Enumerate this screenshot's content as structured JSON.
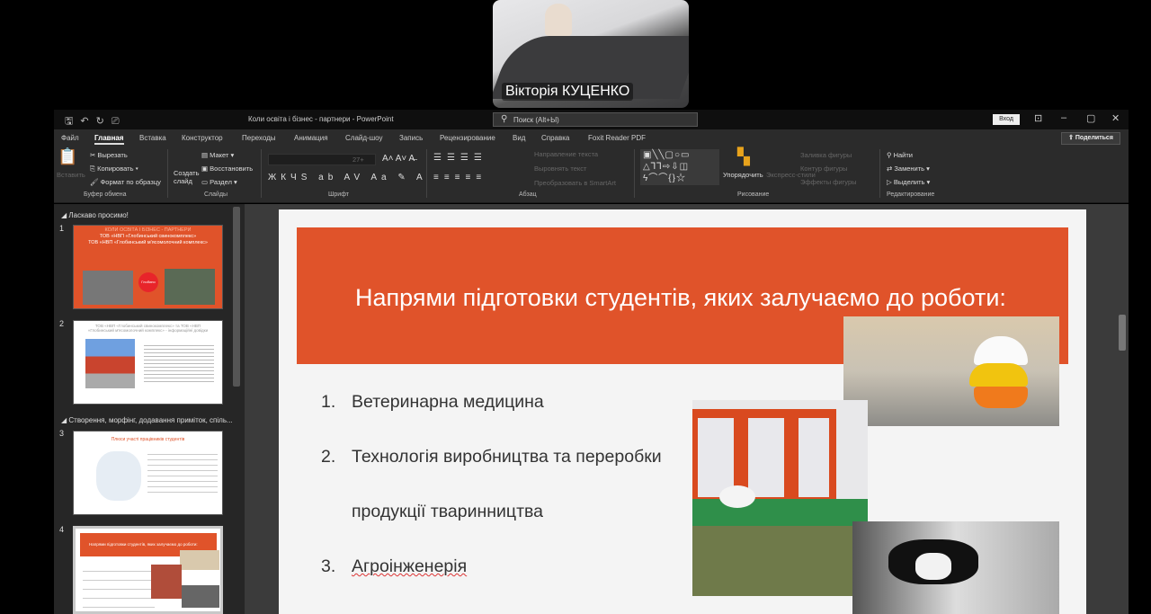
{
  "video": {
    "participant_name": "Вікторія КУЦЕНКО"
  },
  "titlebar": {
    "title": "Коли освіта і бізнес - партнери  -  PowerPoint",
    "search_placeholder": "Поиск (Alt+Ы)",
    "login": "Вход"
  },
  "tabs": [
    "Файл",
    "Главная",
    "Вставка",
    "Конструктор",
    "Переходы",
    "Анимация",
    "Слайд-шоу",
    "Запись",
    "Рецензирование",
    "Вид",
    "Справка",
    "Foxit Reader PDF"
  ],
  "share": "Поделиться",
  "ribbon": {
    "clipboard": {
      "paste": "Вставить",
      "cut": "Вырезать",
      "copy": "Копировать",
      "format_painter": "Формат по образцу",
      "group": "Буфер обмена"
    },
    "slides": {
      "new_slide": "Создать слайд",
      "layout": "Макет",
      "reset": "Восстановить",
      "section": "Раздел",
      "group": "Слайды"
    },
    "font": {
      "size": "27+",
      "group": "Шрифт"
    },
    "paragraph": {
      "text_direction": "Направление текста",
      "align_text": "Выровнять текст",
      "smartart": "Преобразовать в SmartArt",
      "group": "Абзац"
    },
    "drawing": {
      "arrange": "Упорядочить",
      "quick_styles": "Экспресс-стили",
      "fill": "Заливка фигуры",
      "outline": "Контур фигуры",
      "effects": "Эффекты фигуры",
      "group": "Рисование"
    },
    "editing": {
      "find": "Найти",
      "replace": "Заменить",
      "select": "Выделить",
      "group": "Редактирование"
    }
  },
  "panel": {
    "sections": [
      "Ласкаво просимо!",
      "Створення, морфінг, додавання приміток, спіль..."
    ],
    "thumbs": [
      {
        "num": "1",
        "lines": [
          "КОЛИ ОСВІТА І БІЗНЕС - ПАРТНЕРИ",
          "ТОВ «НВП «Глобинський свинокомплекс»",
          "ТОВ «НВП «Глобинський м'ясомолочний комплекс»"
        ],
        "logo": "Глобино"
      },
      {
        "num": "2",
        "lines": [
          "ТОВ «НВП «Глобинський свинокомплекс» та ТОВ «НВП «Глобинський м'ясомолочний комплекс» - інформаційні довідки"
        ]
      },
      {
        "num": "3",
        "lines": [
          "Плюси участі працівників студентів"
        ]
      },
      {
        "num": "4",
        "lines": [
          "Напрями підготовки студентів, яких залучаємо до роботи:"
        ]
      }
    ]
  },
  "slide": {
    "title": "Напрями підготовки студентів, яких залучаємо до роботи:",
    "items": [
      {
        "n": "1.",
        "text": "Ветеринарна медицина"
      },
      {
        "n": "2.",
        "text": "Технологія виробництва та переробки"
      },
      {
        "n": "",
        "text": "продукції тваринництва"
      },
      {
        "n": "3.",
        "text": "Агроінженерія"
      }
    ]
  },
  "colors": {
    "accent": "#e0532a",
    "ribbon": "#2b2b2b"
  }
}
